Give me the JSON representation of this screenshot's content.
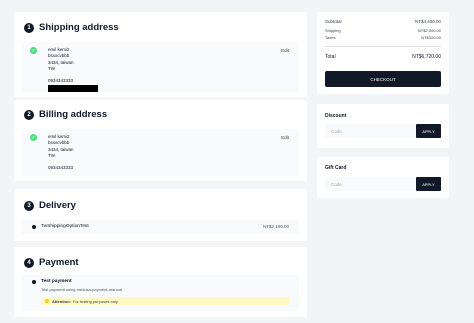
{
  "shipping": {
    "step": "1",
    "title": "Shipping address",
    "edit_label": "Edit",
    "lines": [
      "emil kemi2",
      "bsxxcvbbb",
      "3434, taiwan",
      "TW",
      "",
      "0934343333"
    ]
  },
  "billing": {
    "step": "2",
    "title": "Billing address",
    "edit_label": "Edit",
    "lines": [
      "emil kemi2",
      "bsxxcvbbb",
      "3434, taiwan",
      "TW",
      "",
      "0934343333"
    ]
  },
  "delivery": {
    "step": "3",
    "title": "Delivery",
    "option_label": "TwShippingOptionTest",
    "option_price": "NT$2,100.00"
  },
  "payment": {
    "step": "4",
    "title": "Payment",
    "method_label": "Test payment",
    "method_desc": "Test payment using medusa-payment-manual",
    "attention_label": "Attention:",
    "attention_text": "For testing purposes only."
  },
  "summary": {
    "subtotal_label": "Subtotal",
    "subtotal_value": "NT$4,400.00",
    "shipping_label": "Shipping",
    "shipping_value": "NT$2,000.00",
    "taxes_label": "Taxes",
    "taxes_value": "NT$320.00",
    "total_label": "Total",
    "total_value": "NT$6,720.00",
    "checkout_label": "CHECKOUT"
  },
  "discount": {
    "title": "Discount",
    "placeholder": "Code",
    "apply_label": "APPLY"
  },
  "gift_card": {
    "title": "Gift Card",
    "placeholder": "Code",
    "apply_label": "APPLY"
  },
  "icons": {
    "check": "check-icon",
    "radio": "radio-selected-icon",
    "attention": "info-icon"
  },
  "colors": {
    "primary": "#111827",
    "success": "#4ade80",
    "warning_bg": "#fef9c3",
    "background": "#f3f4f6"
  }
}
